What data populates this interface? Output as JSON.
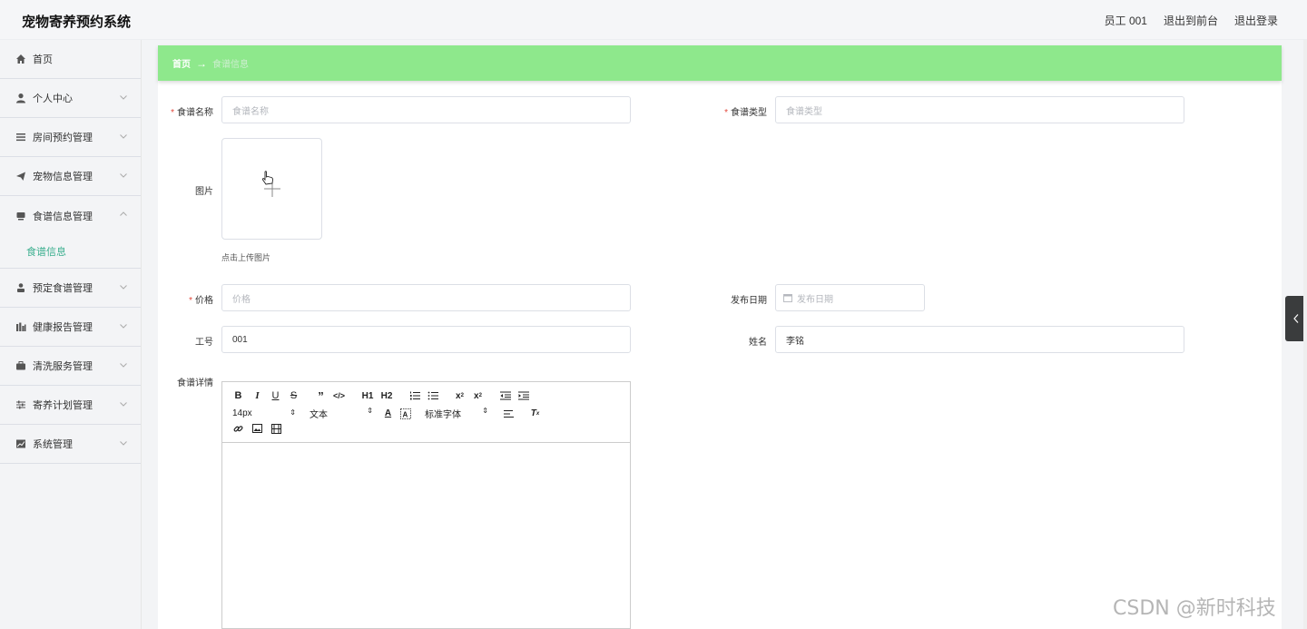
{
  "header": {
    "title": "宠物寄养预约系统",
    "user": "员工 001",
    "to_front": "退出到前台",
    "logout": "退出登录"
  },
  "sidebar": {
    "items": [
      {
        "label": "首页",
        "icon": "home-icon"
      },
      {
        "label": "个人中心",
        "icon": "user-icon"
      },
      {
        "label": "房间预约管理",
        "icon": "list-icon"
      },
      {
        "label": "宠物信息管理",
        "icon": "send-icon"
      },
      {
        "label": "食谱信息管理",
        "icon": "monitor-icon",
        "expanded": true
      },
      {
        "label": "预定食谱管理",
        "icon": "person-icon"
      },
      {
        "label": "健康报告管理",
        "icon": "bar-chart-icon"
      },
      {
        "label": "清洗服务管理",
        "icon": "briefcase-icon"
      },
      {
        "label": "寄养计划管理",
        "icon": "sliders-icon"
      },
      {
        "label": "系统管理",
        "icon": "area-chart-icon"
      }
    ],
    "sub_item": "食谱信息"
  },
  "breadcrumb": {
    "home": "首页",
    "arrow": "→",
    "current": "食谱信息"
  },
  "form": {
    "name_label": "食谱名称",
    "name_placeholder": "食谱名称",
    "type_label": "食谱类型",
    "type_placeholder": "食谱类型",
    "image_label": "图片",
    "upload_tip": "点击上传图片",
    "price_label": "价格",
    "price_placeholder": "价格",
    "date_label": "发布日期",
    "date_placeholder": "发布日期",
    "staff_no_label": "工号",
    "staff_no_value": "001",
    "staff_name_label": "姓名",
    "staff_name_value": "李铭",
    "detail_label": "食谱详情"
  },
  "editor": {
    "font_size": "14px",
    "text_type": "文本",
    "font_family": "标准字体",
    "h1": "H1",
    "h2": "H2"
  },
  "watermark": "CSDN @新时科技",
  "colors": {
    "breadcrumb_bg": "#8ee88c",
    "sub_item": "#3aae8e",
    "required": "#e2473b"
  }
}
